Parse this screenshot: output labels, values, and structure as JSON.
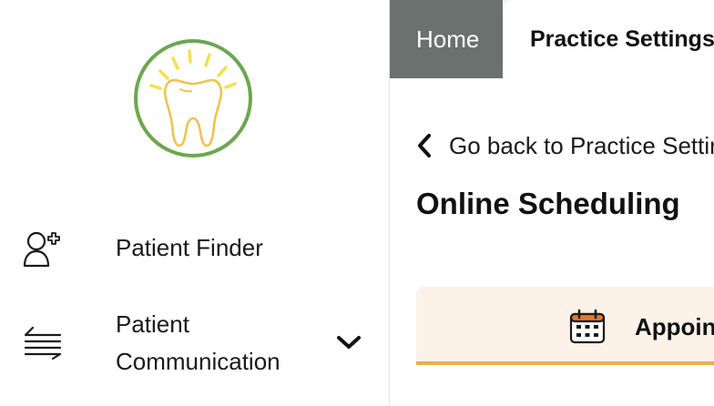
{
  "tabs": {
    "home_label": "Home",
    "practice_settings_label": "Practice Settings"
  },
  "sidebar": {
    "logo_icon": "tooth-logo-icon",
    "items": [
      {
        "label": "Patient Finder",
        "icon": "patient-add-icon"
      },
      {
        "label": "Patient Communication",
        "icon": "transfer-arrows-icon",
        "expand_icon": "chevron-down-icon"
      }
    ]
  },
  "main": {
    "back_label": "Go back to Practice Settings",
    "title": "Online Scheduling",
    "section_label": "Appointments",
    "section_icon": "calendar-icon"
  },
  "colors": {
    "home_tab_bg": "#6b716f",
    "section_bg": "#fdf2e8",
    "section_underline": "#e2b24a",
    "logo_ring": "#6aa84f",
    "logo_tooth": "#f0c24b"
  }
}
